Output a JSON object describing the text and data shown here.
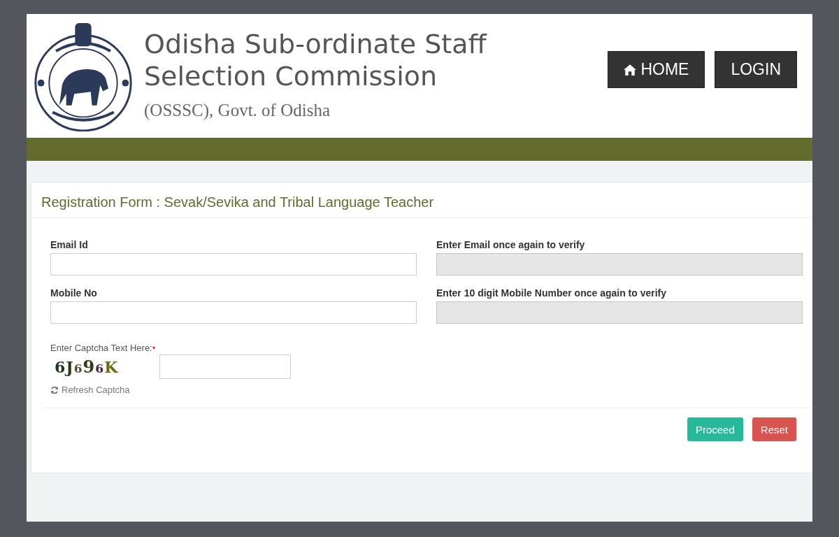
{
  "header": {
    "title_line1": "Odisha Sub-ordinate Staff",
    "title_line2": "Selection Commission",
    "subtitle": "(OSSSC), Govt. of Odisha",
    "nav": [
      {
        "label": "HOME",
        "kind": "home"
      },
      {
        "label": "LOGIN",
        "kind": "plain"
      }
    ]
  },
  "form": {
    "title": "Registration Form : Sevak/Sevika and Tribal Language Teacher",
    "fields": [
      {
        "label": "Email Id",
        "disabled": false
      },
      {
        "label": "Enter Email once again to verify",
        "disabled": true
      },
      {
        "label": "Mobile No",
        "disabled": false
      },
      {
        "label": "Enter 10 digit Mobile Number once again to verify",
        "disabled": true
      }
    ],
    "captcha": {
      "label": "Enter Captcha Text Here:",
      "required_mark": "•",
      "text": "6J696K",
      "refresh": "Refresh Captcha"
    },
    "buttons": [
      {
        "label": "Proceed",
        "kind": "primary"
      },
      {
        "label": "Reset",
        "kind": "danger"
      }
    ]
  }
}
